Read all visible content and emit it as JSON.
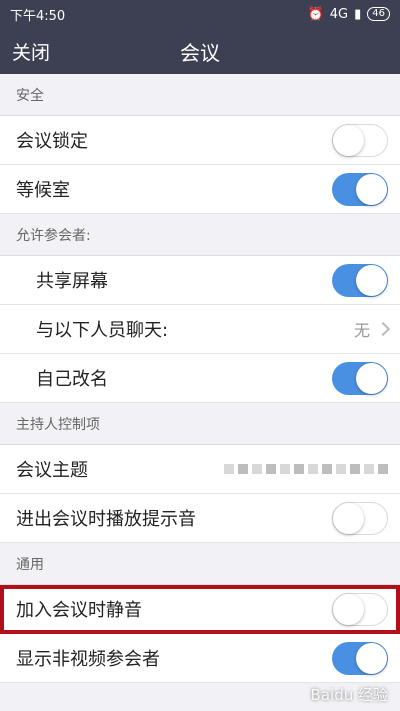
{
  "status": {
    "time": "下午4:50",
    "network": "4G",
    "battery": "46"
  },
  "nav": {
    "close": "关闭",
    "title": "会议"
  },
  "sections": {
    "security": "安全",
    "allow_participants": "允许参会者:",
    "host_controls": "主持人控制项",
    "general": "通用"
  },
  "rows": {
    "lock_meeting": {
      "label": "会议锁定",
      "on": false
    },
    "waiting_room": {
      "label": "等候室",
      "on": true
    },
    "share_screen": {
      "label": "共享屏幕",
      "on": true
    },
    "chat_with": {
      "label": "与以下人员聊天:",
      "value": "无"
    },
    "rename_self": {
      "label": "自己改名",
      "on": true
    },
    "meeting_topic": {
      "label": "会议主题"
    },
    "entry_exit_chime": {
      "label": "进出会议时播放提示音",
      "on": false
    },
    "mute_on_entry": {
      "label": "加入会议时静音",
      "on": false
    },
    "show_non_video": {
      "label": "显示非视频参会者",
      "on": true
    }
  },
  "watermark": "Baidu 经验",
  "colors": {
    "accent": "#4a90e2",
    "navbar": "#3d3f52",
    "highlight": "#b0101a"
  }
}
